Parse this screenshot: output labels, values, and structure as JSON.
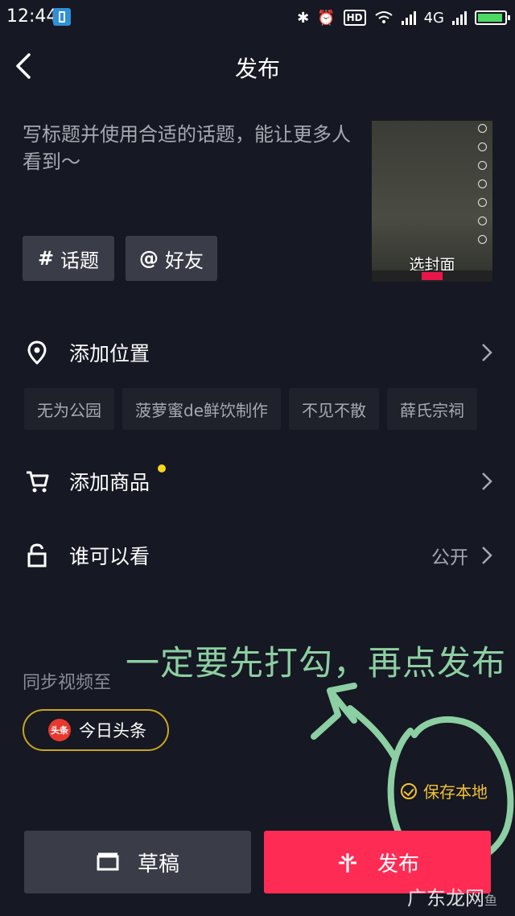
{
  "status": {
    "time": "12:44",
    "hd": "HD",
    "network": "4G"
  },
  "header": {
    "title": "发布"
  },
  "caption": {
    "placeholder": "写标题并使用合适的话题，能让更多人看到～"
  },
  "cover": {
    "label": "选封面"
  },
  "chips": [
    {
      "symbol": "#",
      "label": "话题"
    },
    {
      "symbol": "@",
      "label": "好友"
    }
  ],
  "location": {
    "label": "添加位置",
    "suggestions": [
      "无为公园",
      "菠萝蜜de鲜饮制作",
      "不见不散",
      "薛氏宗祠"
    ]
  },
  "product": {
    "label": "添加商品"
  },
  "privacy": {
    "label": "谁可以看",
    "value": "公开"
  },
  "annotation": {
    "text": "一定要先打勾，再点发布"
  },
  "sync": {
    "label": "同步视频至",
    "target": "今日头条",
    "logo_text": "头条"
  },
  "save_local": {
    "label": "保存本地",
    "checked": true
  },
  "buttons": {
    "draft": "草稿",
    "publish": "发布"
  },
  "watermark": {
    "text": "广东龙网",
    "small": "鱼"
  },
  "colors": {
    "background": "#161823",
    "publish": "#fe2c55",
    "accent_yellow": "#f2c230",
    "annotation_green": "#8ccfa2"
  }
}
